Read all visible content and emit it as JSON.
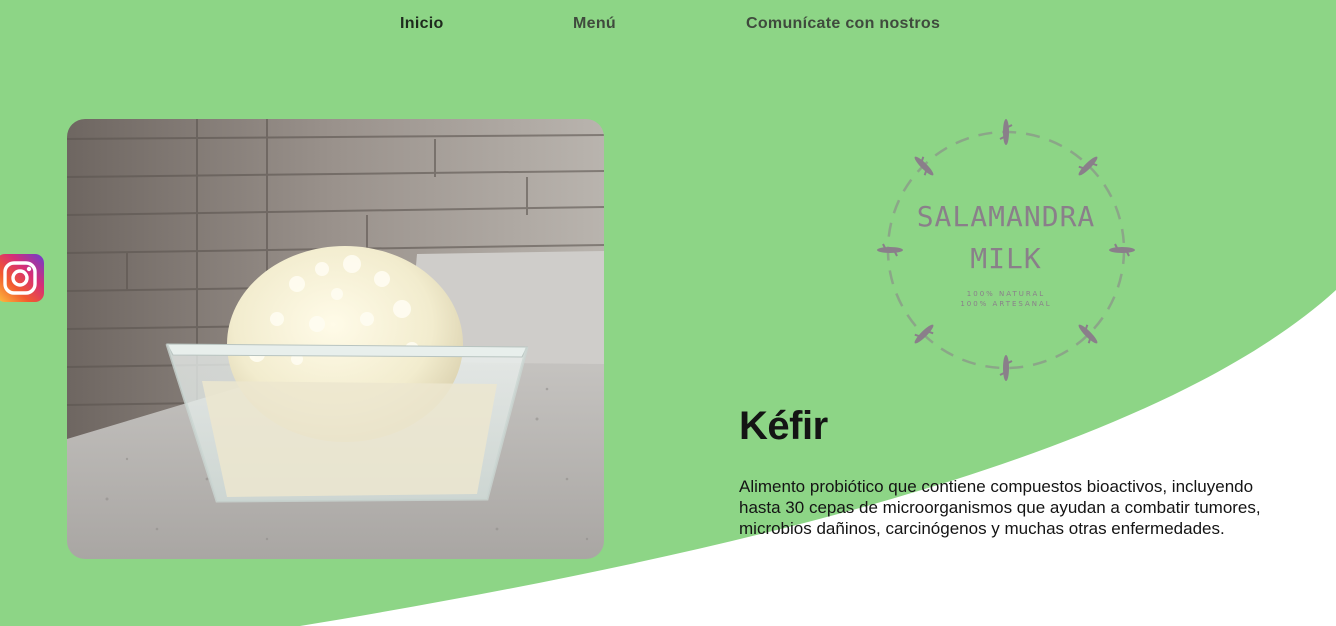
{
  "nav": {
    "items": [
      {
        "label": "Inicio",
        "active": true
      },
      {
        "label": "Menú",
        "active": false
      },
      {
        "label": "Comunícate con nostros",
        "active": false
      }
    ]
  },
  "social": {
    "icon": "instagram-icon"
  },
  "brand": {
    "name_line1": "SALAMANDRA",
    "name_line2": "MILK",
    "tagline_line1": "100% NATURAL",
    "tagline_line2": "100% ARTESANAL"
  },
  "product": {
    "title": "Kéfir",
    "description": "Alimento probiótico que contiene compuestos bioactivos, incluyendo hasta 30 cepas de microorganismos que ayudan a combatir tumores, microbios dañinos, carcinógenos y muchas otras enfermedades."
  },
  "colors": {
    "background_green": "#8dd586",
    "curve_white": "#ffffff",
    "logo_gray": "#8a7f8a",
    "text_dark": "#141414"
  }
}
